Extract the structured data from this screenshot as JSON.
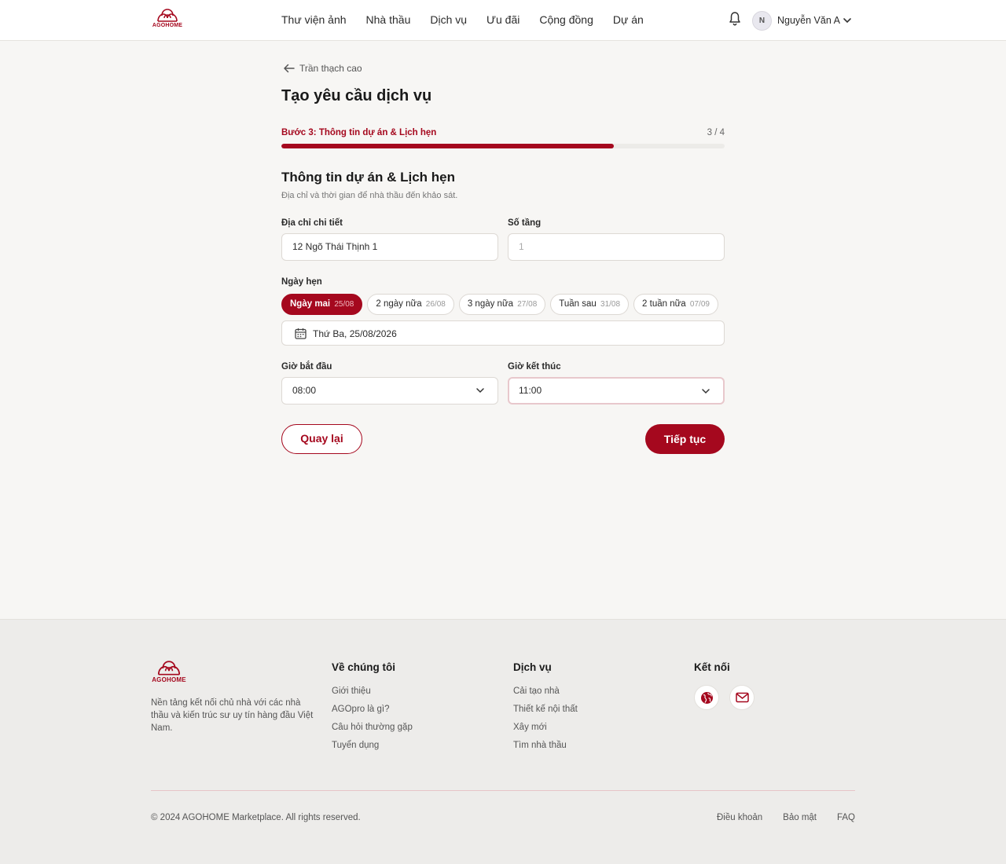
{
  "brand": {
    "name": "AGOHOME",
    "color": "#a5081e"
  },
  "nav": {
    "items": [
      "Thư viện ảnh",
      "Nhà thầu",
      "Dịch vụ",
      "Ưu đãi",
      "Cộng đồng",
      "Dự án"
    ]
  },
  "user": {
    "initial": "N",
    "name": "Nguyễn Văn A"
  },
  "back": {
    "label": "Trần thạch cao"
  },
  "page": {
    "title": "Tạo yêu cầu dịch vụ"
  },
  "progress": {
    "label": "Bước 3: Thông tin dự án & Lịch hẹn",
    "count": "3 / 4",
    "fraction": 0.75
  },
  "section": {
    "title": "Thông tin dự án & Lịch hẹn",
    "subtitle": "Địa chỉ và thời gian để nhà thầu đến khảo sát."
  },
  "form": {
    "address_label": "Địa chỉ chi tiết",
    "address_value": "12 Ngõ Thái Thịnh 1",
    "floors_label": "Số tầng",
    "floors_placeholder": "1",
    "date_label": "Ngày hẹn",
    "date_chips": [
      {
        "label": "Ngày mai",
        "date": "25/08",
        "active": true
      },
      {
        "label": "2 ngày nữa",
        "date": "26/08",
        "active": false
      },
      {
        "label": "3 ngày nữa",
        "date": "27/08",
        "active": false
      },
      {
        "label": "Tuần sau",
        "date": "31/08",
        "active": false
      },
      {
        "label": "2 tuần nữa",
        "date": "07/09",
        "active": false
      }
    ],
    "date_value": "Thứ Ba, 25/08/2026",
    "start_label": "Giờ bắt đầu",
    "start_value": "08:00",
    "end_label": "Giờ kết thúc",
    "end_value": "11:00"
  },
  "buttons": {
    "back": "Quay lại",
    "next": "Tiếp tục"
  },
  "footer": {
    "description": "Nền tảng kết nối chủ nhà với các nhà thầu và kiến trúc sư uy tín hàng đầu Việt Nam.",
    "about": {
      "title": "Về chúng tôi",
      "links": [
        "Giới thiệu",
        "AGOpro là gì?",
        "Câu hỏi thường gặp",
        "Tuyển dụng"
      ]
    },
    "services": {
      "title": "Dịch vụ",
      "links": [
        "Cải tạo nhà",
        "Thiết kế nội thất",
        "Xây mới",
        "Tìm nhà thầu"
      ]
    },
    "connect": {
      "title": "Kết nối",
      "icons": [
        "globe-icon",
        "mail-icon"
      ]
    },
    "copyright": "© 2024 AGOHOME Marketplace. All rights reserved.",
    "bottom_links": [
      "Điều khoản",
      "Bảo mật",
      "FAQ"
    ]
  }
}
